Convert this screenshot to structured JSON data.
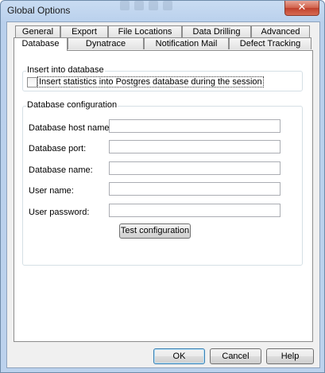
{
  "window": {
    "title": "Global Options",
    "close_glyph": "✕"
  },
  "tabs_row1": [
    {
      "label": "General"
    },
    {
      "label": "Export"
    },
    {
      "label": "File Locations"
    },
    {
      "label": "Data Drilling"
    },
    {
      "label": "Advanced"
    }
  ],
  "tabs_row2": [
    {
      "label": "Database",
      "selected": true
    },
    {
      "label": "Dynatrace"
    },
    {
      "label": "Notification Mail"
    },
    {
      "label": "Defect Tracking"
    }
  ],
  "insert_group": {
    "legend": "Insert into database",
    "checkbox_label": "Insert statistics into Postgres database during the session",
    "checked": false
  },
  "config_group": {
    "legend": "Database configuration",
    "fields": [
      {
        "label": "Database host name:",
        "value": ""
      },
      {
        "label": "Database port:",
        "value": ""
      },
      {
        "label": "Database name:",
        "value": ""
      },
      {
        "label": "User name:",
        "value": ""
      },
      {
        "label": "User password:",
        "value": ""
      }
    ],
    "test_button": "Test configuration"
  },
  "footer": {
    "ok": "OK",
    "cancel": "Cancel",
    "help": "Help"
  }
}
